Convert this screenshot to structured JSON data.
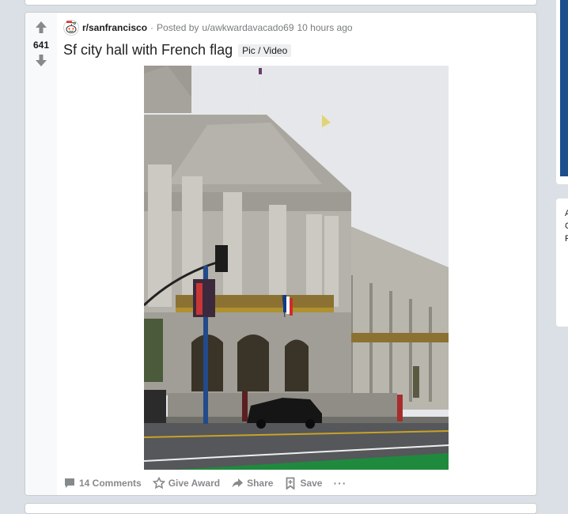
{
  "post": {
    "score": "641",
    "subreddit": "r/sanfrancisco",
    "separator": "·",
    "posted_by_prefix": "Posted by",
    "author": "u/awkwardavacado69",
    "time_ago": "10 hours ago",
    "title": "Sf city hall with French flag",
    "flair": "Pic / Video",
    "icons": {
      "upvote": "upvote-arrow-icon",
      "downvote": "downvote-arrow-icon",
      "subreddit": "snoo-avatar-icon"
    },
    "actions": {
      "comments": "14 Comments",
      "award": "Give Award",
      "share": "Share",
      "save": "Save",
      "more": "···"
    }
  },
  "sidebar": {
    "visible_letters": [
      "A",
      "C",
      "F"
    ]
  },
  "colors": {
    "page_bg": "#dae0e6",
    "card_bg": "#ffffff",
    "vote_col_bg": "#f8f9fa",
    "muted_text": "#878a8c",
    "sidebar_band": "#1c4f8c"
  }
}
